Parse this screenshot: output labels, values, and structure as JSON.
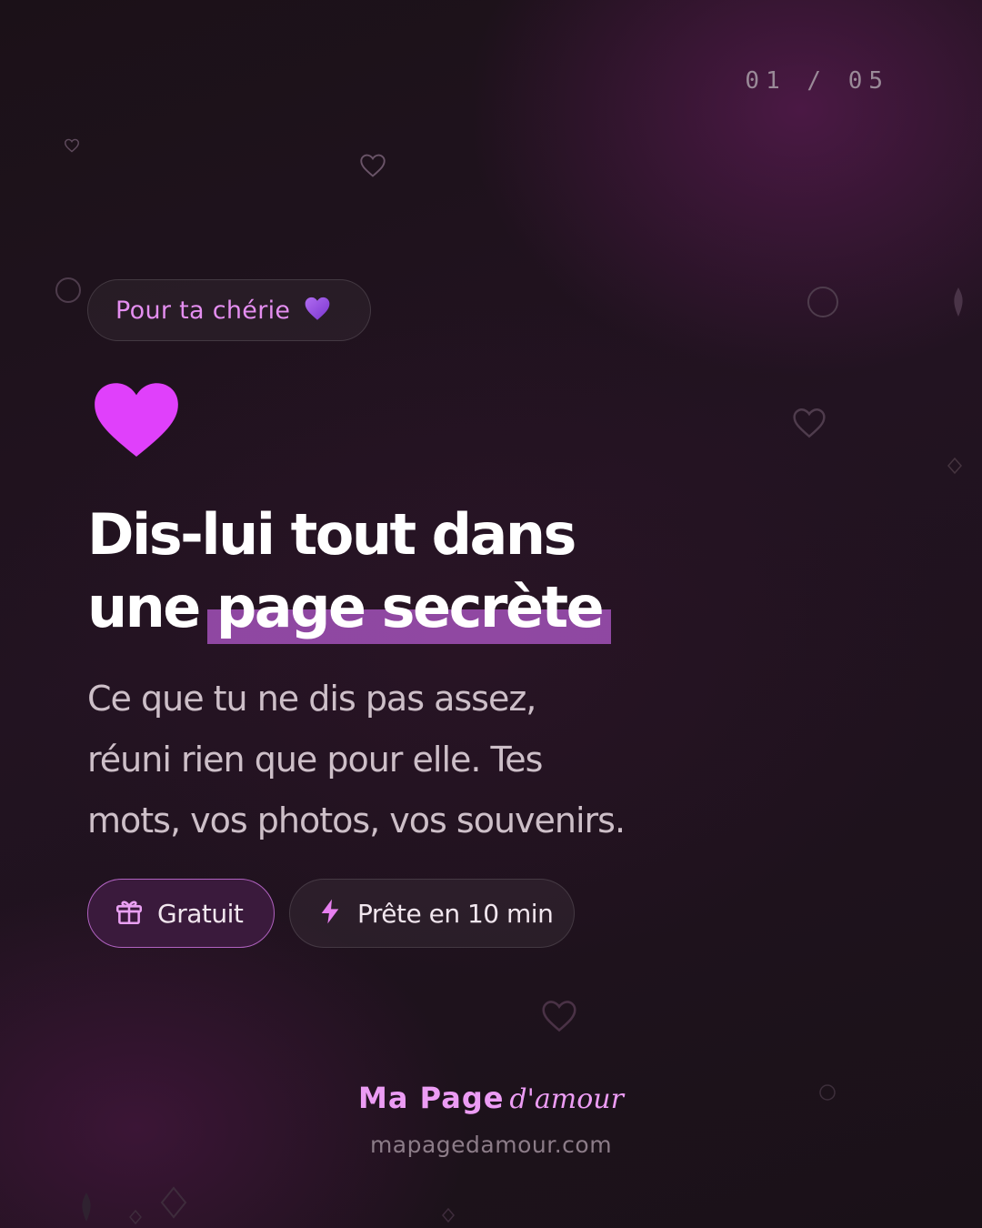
{
  "counter": "01 / 05",
  "tag": {
    "label": "Pour ta chérie",
    "emoji": "💜"
  },
  "headline": {
    "line1": "Dis-lui tout dans",
    "line2_plain": "une",
    "line2_highlight": "page secrète"
  },
  "subtitle": {
    "line1": "Ce que tu ne dis pas assez,",
    "line2": "réuni rien que pour elle. Tes",
    "line3": "mots, vos photos, vos souvenirs."
  },
  "chips": [
    {
      "icon": "gift-icon",
      "label": "Gratuit"
    },
    {
      "icon": "lightning-icon",
      "label": "Prête en 10 min"
    }
  ],
  "brand": {
    "name": "Ma Page",
    "script": "d'amour",
    "domain": "mapagedamour.com"
  },
  "colors": {
    "accent": "#e040fb",
    "pink_text": "#e48ef0",
    "highlight": "#9b4eb0",
    "background": "#1b1118"
  }
}
